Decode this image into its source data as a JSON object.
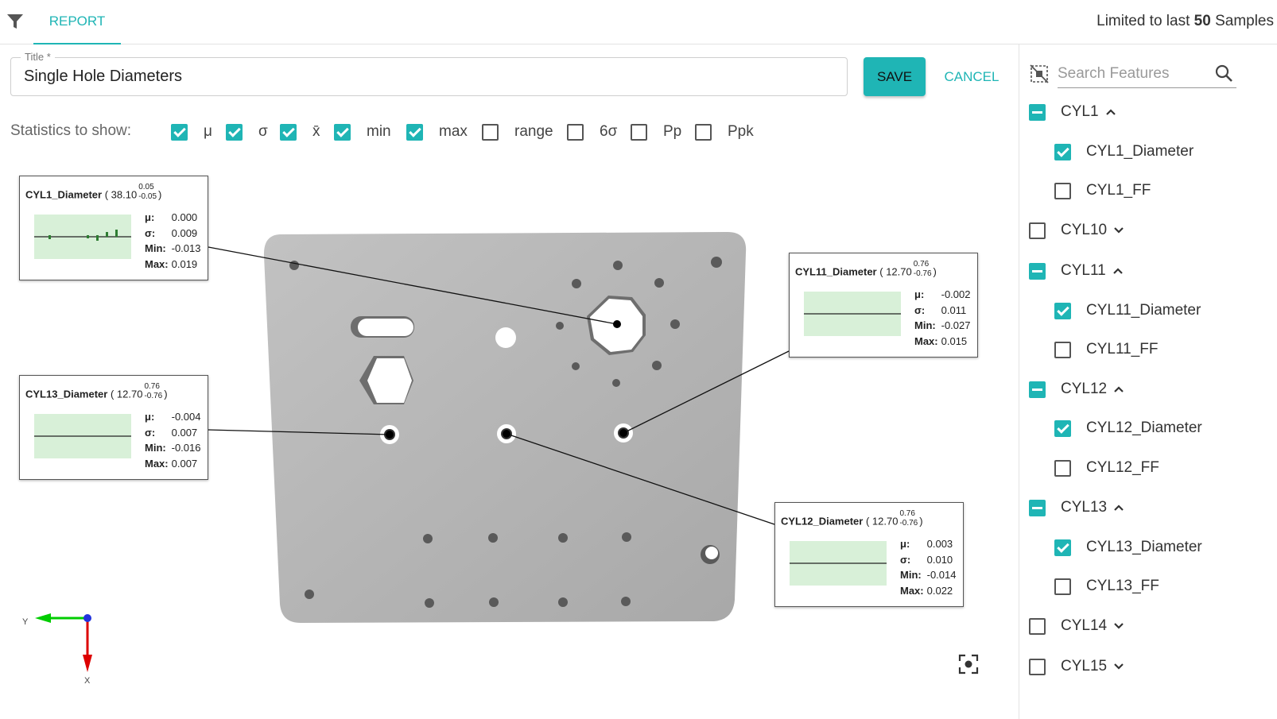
{
  "toolbar": {
    "tab_label": "REPORT",
    "limit_prefix": "Limited to last",
    "limit_count": "50",
    "limit_suffix": "Samples"
  },
  "form": {
    "title_label": "Title *",
    "title_value": "Single Hole Diameters",
    "save_label": "SAVE",
    "cancel_label": "CANCEL"
  },
  "statistics": {
    "label": "Statistics to show:",
    "items": [
      {
        "label": "μ",
        "checked": true
      },
      {
        "label": "σ",
        "checked": true
      },
      {
        "label": "x̄",
        "checked": true
      },
      {
        "label": "min",
        "checked": true
      },
      {
        "label": "max",
        "checked": true
      },
      {
        "label": "range",
        "checked": false
      },
      {
        "label": "6σ",
        "checked": false
      },
      {
        "label": "Pp",
        "checked": false
      },
      {
        "label": "Ppk",
        "checked": false
      }
    ]
  },
  "cards": [
    {
      "name": "CYL1_Diameter",
      "nominal": "38.10",
      "tol_upper": "0.05",
      "tol_lower": "-0.05",
      "mu": "0.000",
      "sigma": "0.009",
      "min": "-0.013",
      "max": "0.019"
    },
    {
      "name": "CYL13_Diameter",
      "nominal": "12.70",
      "tol_upper": "0.76",
      "tol_lower": "-0.76",
      "mu": "-0.004",
      "sigma": "0.007",
      "min": "-0.016",
      "max": "0.007"
    },
    {
      "name": "CYL11_Diameter",
      "nominal": "12.70",
      "tol_upper": "0.76",
      "tol_lower": "-0.76",
      "mu": "-0.002",
      "sigma": "0.011",
      "min": "-0.027",
      "max": "0.015"
    },
    {
      "name": "CYL12_Diameter",
      "nominal": "12.70",
      "tol_upper": "0.76",
      "tol_lower": "-0.76",
      "mu": "0.003",
      "sigma": "0.010",
      "min": "-0.014",
      "max": "0.022"
    }
  ],
  "stat_labels": {
    "mu": "μ:",
    "sigma": "σ:",
    "min": "Min:",
    "max": "Max:"
  },
  "axes": {
    "y": "Y",
    "x": "X"
  },
  "sidebar": {
    "search_placeholder": "Search Features",
    "tree": [
      {
        "label": "CYL1",
        "state": "mixed",
        "expanded": true,
        "level": 0
      },
      {
        "label": "CYL1_Diameter",
        "state": "checked",
        "level": 1
      },
      {
        "label": "CYL1_FF",
        "state": "unchecked",
        "level": 1
      },
      {
        "label": "CYL10",
        "state": "unchecked",
        "expanded": false,
        "level": 0
      },
      {
        "label": "CYL11",
        "state": "mixed",
        "expanded": true,
        "level": 0
      },
      {
        "label": "CYL11_Diameter",
        "state": "checked",
        "level": 1
      },
      {
        "label": "CYL11_FF",
        "state": "unchecked",
        "level": 1
      },
      {
        "label": "CYL12",
        "state": "mixed",
        "expanded": true,
        "level": 0
      },
      {
        "label": "CYL12_Diameter",
        "state": "checked",
        "level": 1
      },
      {
        "label": "CYL12_FF",
        "state": "unchecked",
        "level": 1
      },
      {
        "label": "CYL13",
        "state": "mixed",
        "expanded": true,
        "level": 0
      },
      {
        "label": "CYL13_Diameter",
        "state": "checked",
        "level": 1
      },
      {
        "label": "CYL13_FF",
        "state": "unchecked",
        "level": 1
      },
      {
        "label": "CYL14",
        "state": "unchecked",
        "expanded": false,
        "level": 0
      },
      {
        "label": "CYL15",
        "state": "unchecked",
        "expanded": false,
        "level": 0
      }
    ]
  },
  "colors": {
    "accent": "#1fb5b5",
    "plate": "#b3b3b3",
    "chart_band": "#d8f0d8"
  }
}
